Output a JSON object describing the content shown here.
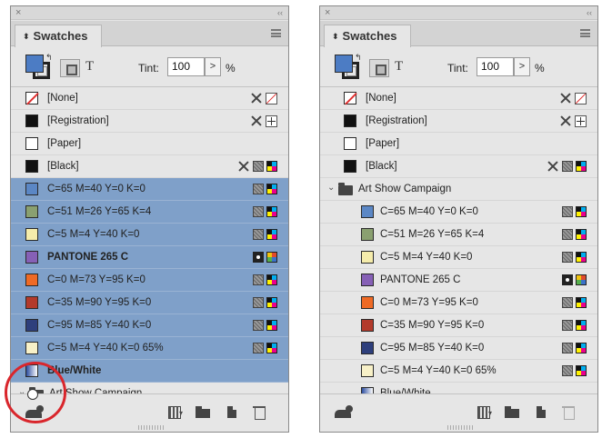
{
  "panels": [
    {
      "tab_label": "Swatches",
      "tint_label": "Tint:",
      "tint_value": "100",
      "tint_arrow": ">",
      "tint_unit": "%",
      "fill_color": "#4c7cc4",
      "group_name": "Art Show Campaign",
      "group_chevron": "⌄",
      "rows": [
        {
          "name": "[None]",
          "color": "none",
          "selected": false
        },
        {
          "name": "[Registration]",
          "color": "#111111",
          "selected": false
        },
        {
          "name": "[Paper]",
          "color": "#ffffff",
          "selected": false
        },
        {
          "name": "[Black]",
          "color": "#111111",
          "selected": false
        },
        {
          "name": "C=65 M=40 Y=0 K=0",
          "color": "#5b87c5",
          "selected": true
        },
        {
          "name": "C=51 M=26 Y=65 K=4",
          "color": "#8aa070",
          "selected": true
        },
        {
          "name": "C=5 M=4 Y=40 K=0",
          "color": "#f5ecab",
          "selected": true
        },
        {
          "name": "PANTONE 265 C",
          "color": "#8660b6",
          "selected": true
        },
        {
          "name": "C=0 M=73 Y=95 K=0",
          "color": "#ef6a25",
          "selected": true
        },
        {
          "name": "C=35 M=90 Y=95 K=0",
          "color": "#b33a2b",
          "selected": true
        },
        {
          "name": "C=95 M=85 Y=40 K=0",
          "color": "#2e3f7c",
          "selected": true
        },
        {
          "name": "C=5 M=4 Y=40 K=0 65%",
          "color": "#f8f1c8",
          "selected": true
        },
        {
          "name": "Blue/White",
          "color": "gradient",
          "selected": true
        }
      ]
    },
    {
      "tab_label": "Swatches",
      "tint_label": "Tint:",
      "tint_value": "100",
      "tint_arrow": ">",
      "tint_unit": "%",
      "fill_color": "#4c7cc4",
      "group_name": "Art Show Campaign",
      "group_chevron": "⌄",
      "rows": [
        {
          "name": "[None]",
          "color": "none"
        },
        {
          "name": "[Registration]",
          "color": "#111111"
        },
        {
          "name": "[Paper]",
          "color": "#ffffff"
        },
        {
          "name": "[Black]",
          "color": "#111111"
        },
        {
          "name": "C=65 M=40 Y=0 K=0",
          "color": "#5b87c5"
        },
        {
          "name": "C=51 M=26 Y=65 K=4",
          "color": "#8aa070"
        },
        {
          "name": "C=5 M=4 Y=40 K=0",
          "color": "#f5ecab"
        },
        {
          "name": "PANTONE 265 C",
          "color": "#8660b6"
        },
        {
          "name": "C=0 M=73 Y=95 K=0",
          "color": "#ef6a25"
        },
        {
          "name": "C=35 M=90 Y=95 K=0",
          "color": "#b33a2b"
        },
        {
          "name": "C=95 M=85 Y=40 K=0",
          "color": "#2e3f7c"
        },
        {
          "name": "C=5 M=4 Y=40 K=0 65%",
          "color": "#f8f1c8"
        },
        {
          "name": "Blue/White",
          "color": "gradient"
        }
      ]
    }
  ],
  "highlight_color": "#d9262c",
  "selection_color": "#7fa0c9"
}
